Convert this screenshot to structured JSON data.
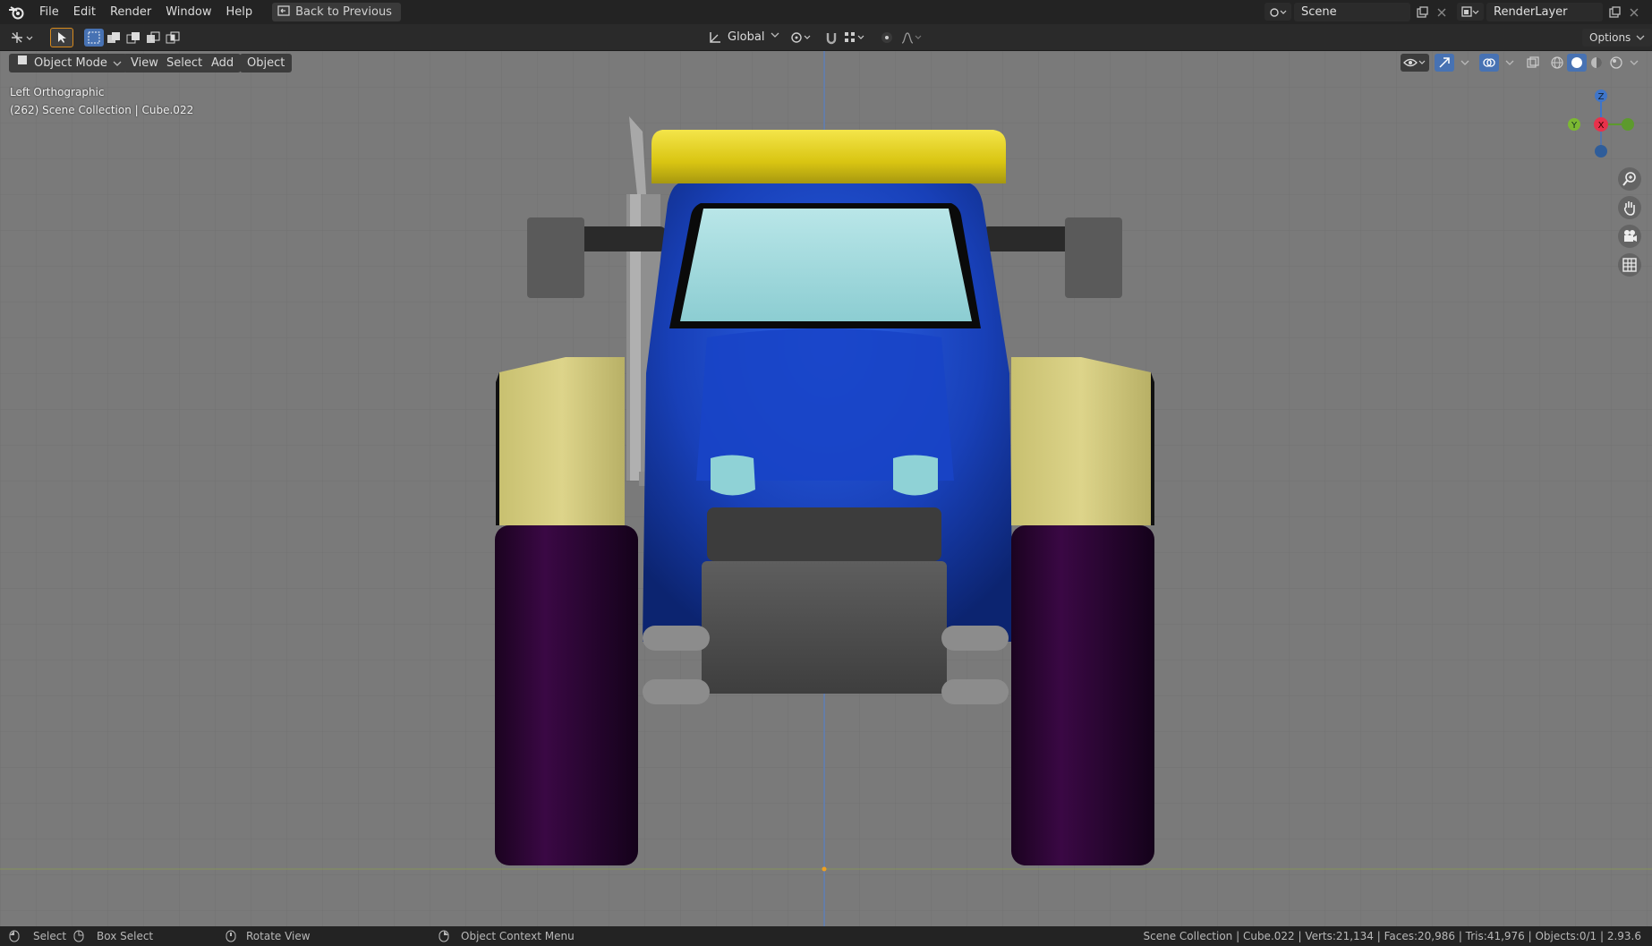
{
  "topbar": {
    "menus": [
      "File",
      "Edit",
      "Render",
      "Window",
      "Help"
    ],
    "back_label": "Back to Previous",
    "scene_name": "Scene",
    "render_layer": "RenderLayer"
  },
  "tool_header": {
    "orientation": "Global",
    "options_label": "Options"
  },
  "viewport_header": {
    "mode": "Object Mode",
    "menus": [
      "View",
      "Select",
      "Add",
      "Object"
    ]
  },
  "viewport": {
    "view_name": "Left Orthographic",
    "collection_info": "(262) Scene Collection | Cube.022",
    "gizmo": {
      "z": "Z",
      "y": "Y",
      "x": "X"
    }
  },
  "statusbar": {
    "select": "Select",
    "box_select": "Box Select",
    "rotate_view": "Rotate View",
    "context_menu": "Object Context Menu",
    "stats": "Scene Collection | Cube.022 | Verts:21,134 | Faces:20,986 | Tris:41,976 | Objects:0/1 | 2.93.6"
  },
  "colors": {
    "body_blue": "#1a3fb0",
    "roof_yellow": "#e6d21a",
    "fender_cream": "#d8cf80",
    "tire_purple": "#2a0630",
    "glass": "#a8dde0"
  }
}
